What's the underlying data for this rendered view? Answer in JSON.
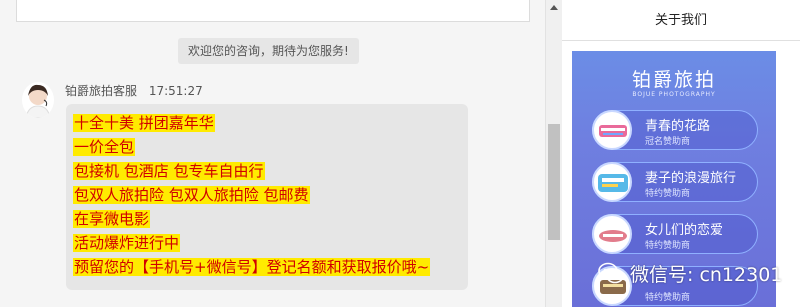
{
  "chat": {
    "system_notice": "欢迎您的咨询，期待为您服务!",
    "agent_name": "铂爵旅拍客服",
    "timestamp": "17:51:27",
    "message_lines": [
      "十全十美   拼团嘉年华",
      "一价全包",
      "包接机 包酒店 包专车自由行",
      "包双人旅拍险 包双人旅拍险  包邮费",
      "在享微电影",
      "活动爆炸进行中",
      "预留您的【手机号+微信号】登记名额和获取报价哦~"
    ]
  },
  "side_panel": {
    "tab_label": "关于我们",
    "brand_title": "铂爵旅拍",
    "brand_subtitle": "BOJUE PHOTOGRAPHY",
    "items": [
      {
        "title": "青春的花路",
        "subtitle": "冠名赞助商"
      },
      {
        "title": "妻子的浪漫旅行",
        "subtitle": "特约赞助商"
      },
      {
        "title": "女儿们的恋爱",
        "subtitle": "特约赞助商"
      },
      {
        "title": "",
        "subtitle": "特约赞助商"
      }
    ]
  },
  "watermark": {
    "text": "微信号: cn12301"
  },
  "colors": {
    "message_text": "#d00000",
    "highlight": "#ffeb00",
    "poster_bg": "#6b7fe0"
  }
}
